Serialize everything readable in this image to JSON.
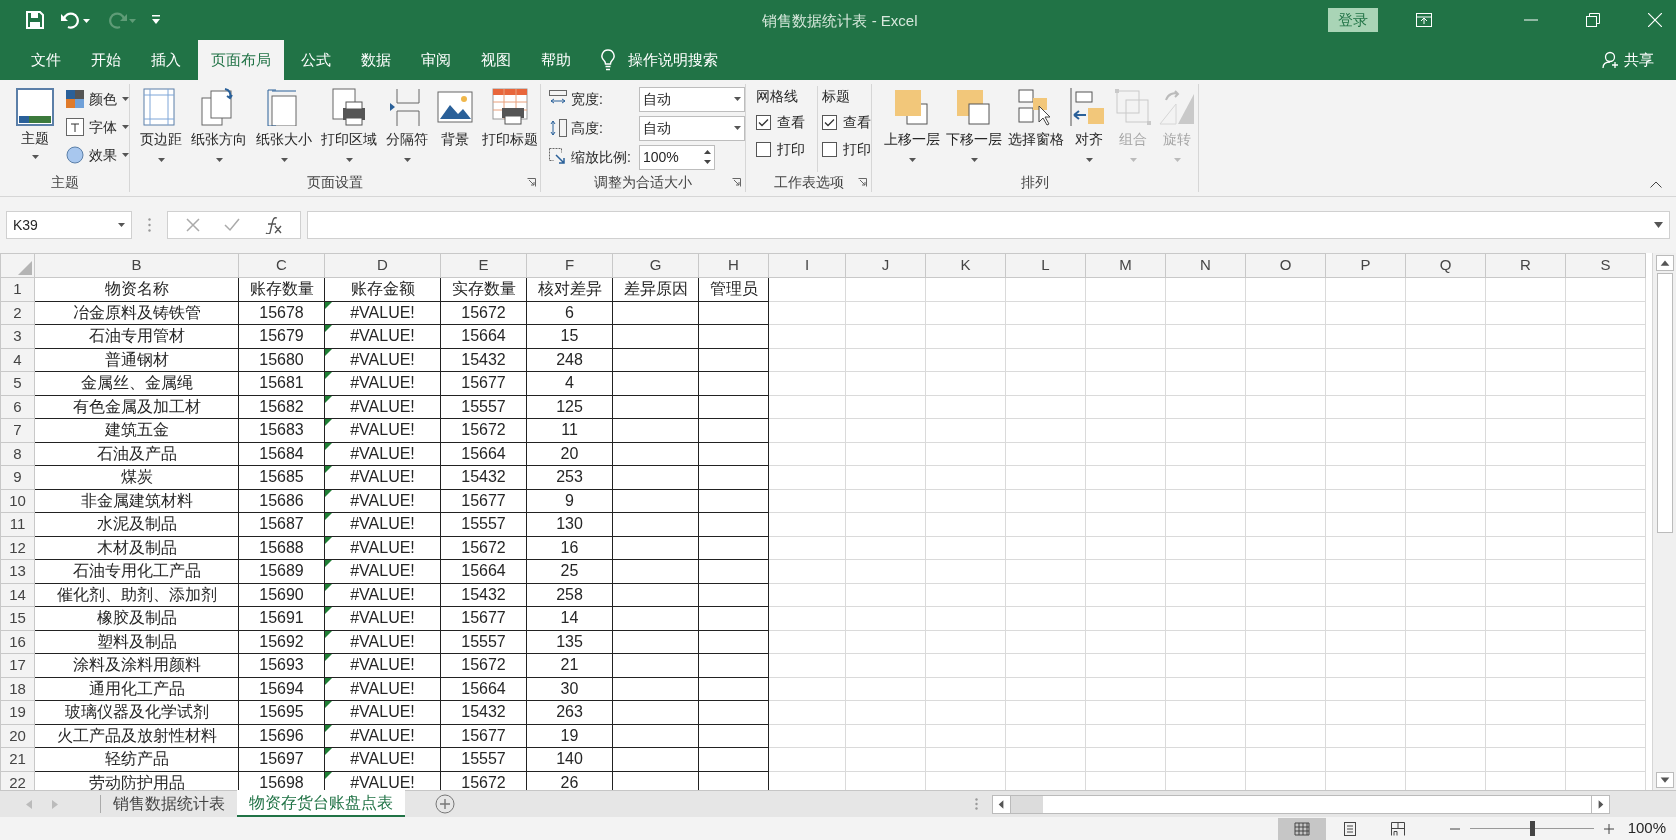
{
  "title_bar": {
    "title": "销售数据统计表  -  Excel",
    "login": "登录"
  },
  "menu_tabs": [
    {
      "label": "文件",
      "selected": false
    },
    {
      "label": "开始",
      "selected": false
    },
    {
      "label": "插入",
      "selected": false
    },
    {
      "label": "页面布局",
      "selected": true
    },
    {
      "label": "公式",
      "selected": false
    },
    {
      "label": "数据",
      "selected": false
    },
    {
      "label": "审阅",
      "selected": false
    },
    {
      "label": "视图",
      "selected": false
    },
    {
      "label": "帮助",
      "selected": false
    }
  ],
  "tell_me": "操作说明搜索",
  "share": "共享",
  "ribbon": {
    "theme_group": {
      "name": "主题",
      "button": "主题",
      "items": [
        "颜色",
        "字体",
        "效果"
      ]
    },
    "page_setup": {
      "name": "页面设置",
      "buttons": [
        {
          "label": "页边距",
          "dropdown": true
        },
        {
          "label": "纸张方向",
          "dropdown": true
        },
        {
          "label": "纸张大小",
          "dropdown": true
        },
        {
          "label": "打印区域",
          "dropdown": true
        },
        {
          "label": "分隔符",
          "dropdown": true
        },
        {
          "label": "背景",
          "dropdown": false
        },
        {
          "label": "打印标题",
          "dropdown": false
        }
      ]
    },
    "scale_group": {
      "name": "调整为合适大小",
      "fields": [
        {
          "label": "宽度:",
          "value": "自动"
        },
        {
          "label": "高度:",
          "value": "自动"
        },
        {
          "label": "缩放比例:",
          "value": "100%"
        }
      ]
    },
    "sheet_options": {
      "name": "工作表选项",
      "columns": [
        {
          "title": "网格线",
          "options": [
            {
              "label": "查看",
              "checked": true
            },
            {
              "label": "打印",
              "checked": false
            }
          ]
        },
        {
          "title": "标题",
          "options": [
            {
              "label": "查看",
              "checked": true
            },
            {
              "label": "打印",
              "checked": false
            }
          ]
        }
      ]
    },
    "arrange": {
      "name": "排列",
      "buttons": [
        {
          "label": "上移一层",
          "dropdown": true,
          "disabled": false
        },
        {
          "label": "下移一层",
          "dropdown": true,
          "disabled": false
        },
        {
          "label": "选择窗格",
          "dropdown": false,
          "disabled": false
        },
        {
          "label": "对齐",
          "dropdown": true,
          "disabled": false
        },
        {
          "label": "组合",
          "dropdown": true,
          "disabled": true
        },
        {
          "label": "旋转",
          "dropdown": true,
          "disabled": true
        }
      ]
    }
  },
  "name_box": "K39",
  "columns": [
    "B",
    "C",
    "D",
    "E",
    "F",
    "G",
    "H",
    "I",
    "J",
    "K",
    "L",
    "M",
    "N",
    "O",
    "P",
    "Q",
    "R",
    "S"
  ],
  "rows": [
    {
      "number": "1",
      "flagged": false,
      "cells": [
        "物资名称",
        "账存数量",
        "账存金额",
        "实存数量",
        "核对差异",
        "差异原因",
        "管理员"
      ]
    },
    {
      "number": "2",
      "flagged": true,
      "cells": [
        "冶金原料及铸铁管",
        "15678",
        "#VALUE!",
        "15672",
        "6",
        "",
        ""
      ]
    },
    {
      "number": "3",
      "flagged": true,
      "cells": [
        "石油专用管材",
        "15679",
        "#VALUE!",
        "15664",
        "15",
        "",
        ""
      ]
    },
    {
      "number": "4",
      "flagged": true,
      "cells": [
        "普通钢材",
        "15680",
        "#VALUE!",
        "15432",
        "248",
        "",
        ""
      ]
    },
    {
      "number": "5",
      "flagged": true,
      "cells": [
        "金属丝、金属绳",
        "15681",
        "#VALUE!",
        "15677",
        "4",
        "",
        ""
      ]
    },
    {
      "number": "6",
      "flagged": true,
      "cells": [
        "有色金属及加工材",
        "15682",
        "#VALUE!",
        "15557",
        "125",
        "",
        ""
      ]
    },
    {
      "number": "7",
      "flagged": true,
      "cells": [
        "建筑五金",
        "15683",
        "#VALUE!",
        "15672",
        "11",
        "",
        ""
      ]
    },
    {
      "number": "8",
      "flagged": true,
      "cells": [
        "石油及产品",
        "15684",
        "#VALUE!",
        "15664",
        "20",
        "",
        ""
      ]
    },
    {
      "number": "9",
      "flagged": true,
      "cells": [
        "煤炭",
        "15685",
        "#VALUE!",
        "15432",
        "253",
        "",
        ""
      ]
    },
    {
      "number": "10",
      "flagged": true,
      "cells": [
        "非金属建筑材料",
        "15686",
        "#VALUE!",
        "15677",
        "9",
        "",
        ""
      ]
    },
    {
      "number": "11",
      "flagged": true,
      "cells": [
        "水泥及制品",
        "15687",
        "#VALUE!",
        "15557",
        "130",
        "",
        ""
      ]
    },
    {
      "number": "12",
      "flagged": true,
      "cells": [
        "木材及制品",
        "15688",
        "#VALUE!",
        "15672",
        "16",
        "",
        ""
      ]
    },
    {
      "number": "13",
      "flagged": true,
      "cells": [
        "石油专用化工产品",
        "15689",
        "#VALUE!",
        "15664",
        "25",
        "",
        ""
      ]
    },
    {
      "number": "14",
      "flagged": true,
      "cells": [
        "催化剂、助剂、添加剂",
        "15690",
        "#VALUE!",
        "15432",
        "258",
        "",
        ""
      ]
    },
    {
      "number": "15",
      "flagged": true,
      "cells": [
        "橡胶及制品",
        "15691",
        "#VALUE!",
        "15677",
        "14",
        "",
        ""
      ]
    },
    {
      "number": "16",
      "flagged": true,
      "cells": [
        "塑料及制品",
        "15692",
        "#VALUE!",
        "15557",
        "135",
        "",
        ""
      ]
    },
    {
      "number": "17",
      "flagged": true,
      "cells": [
        "涂料及涂料用颜料",
        "15693",
        "#VALUE!",
        "15672",
        "21",
        "",
        ""
      ]
    },
    {
      "number": "18",
      "flagged": true,
      "cells": [
        "通用化工产品",
        "15694",
        "#VALUE!",
        "15664",
        "30",
        "",
        ""
      ]
    },
    {
      "number": "19",
      "flagged": true,
      "cells": [
        "玻璃仪器及化学试剂",
        "15695",
        "#VALUE!",
        "15432",
        "263",
        "",
        ""
      ]
    },
    {
      "number": "20",
      "flagged": true,
      "cells": [
        "火工产品及放射性材料",
        "15696",
        "#VALUE!",
        "15677",
        "19",
        "",
        ""
      ]
    },
    {
      "number": "21",
      "flagged": true,
      "cells": [
        "轻纺产品",
        "15697",
        "#VALUE!",
        "15557",
        "140",
        "",
        ""
      ]
    },
    {
      "number": "22",
      "flagged": true,
      "cells": [
        "劳动防护用品",
        "15698",
        "#VALUE!",
        "15672",
        "26",
        "",
        ""
      ]
    }
  ],
  "sheet_tabs": [
    {
      "label": "销售数据统计表",
      "selected": false
    },
    {
      "label": "物资存货台账盘点表",
      "selected": true
    }
  ],
  "status_bar": {
    "views": [
      {
        "kind": "normal",
        "selected": true
      },
      {
        "kind": "page_layout",
        "selected": false
      },
      {
        "kind": "page_break",
        "selected": false
      }
    ],
    "zoom": {
      "level": 0.5,
      "reading": "100%"
    }
  }
}
